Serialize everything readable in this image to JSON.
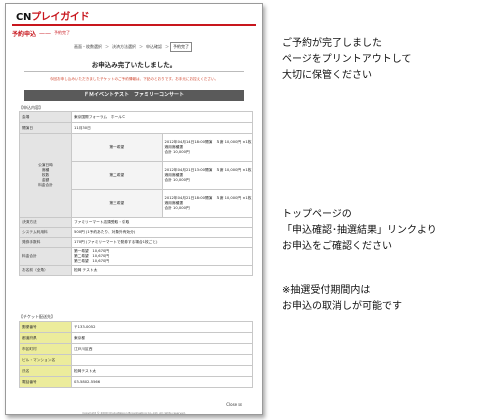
{
  "screenshot": {
    "logo": {
      "cn": "CN",
      "play": "プレイガイド"
    },
    "page_title": "予約申込",
    "page_subtitle": "予約完了",
    "steps": [
      "画面・枚数選択",
      "決済方法選択",
      "申込確認",
      "予約完了"
    ],
    "current_step_index": 3,
    "done_message": "お申込み完了いたしました。",
    "notice_lines": [
      "今回お申し込みいただきましたチケットのご予約情報は、下記のとおりです。お手元にお控えください。"
    ],
    "event_title": "ＦＭイベントテスト　ファミリーコンサート",
    "reservation_section": "【申込内容】",
    "reservation_rows": {
      "venue_label": "会場",
      "venue_value": "東京国際フォーラム　ホールＣ",
      "date_label": "開演日",
      "date_value": "11月30日",
      "seat_label": "公演日時\n席種\n枚数\n金額\n料金合計",
      "prize_groups": [
        {
          "label": "第一希望",
          "lines": [
            "2012年04月14日18:00開演　Ｓ席 10,000円 ×1枚",
            "適用席種選",
            "合計 10,000円"
          ]
        },
        {
          "label": "第二希望",
          "lines": [
            "2012年04月21日13:00開演　Ｓ席 10,000円 ×1枚",
            "適用席種選",
            "合計 10,000円"
          ]
        },
        {
          "label": "第三希望",
          "lines": [
            "2012年04月21日18:00開演　Ｓ席 10,000円 ×1枚",
            "適用席種選",
            "合計 10,000円"
          ]
        }
      ],
      "payment_label": "決済方法",
      "payment_value": "ファミリーマート店頭受取・引取",
      "system_fee_label": "システム利用料",
      "system_fee_value": "500円 (1予約あたり、対象外有効分)",
      "ticket_fee_label": "発券手数料",
      "ticket_fee_value": "170円 (ファミリーマートで発券する場合1枚ごと)",
      "total_label": "料金合計",
      "total_lines": [
        "第一希望　10,670円",
        "第二希望　10,670円",
        "第三希望　10,670円"
      ],
      "name_label": "お名前（全角）",
      "name_value": "松岡 テスト太"
    },
    "ticket_section": "【チケット配送先】",
    "ticket_rows": [
      {
        "label": "郵便番号",
        "value": "〒133-0052"
      },
      {
        "label": "都道府県",
        "value": "東京都"
      },
      {
        "label": "市区町村",
        "value": "江戸川区西"
      },
      {
        "label": "ビル・マンション名",
        "value": ""
      },
      {
        "label": "氏名",
        "value": "松岡テスト太"
      },
      {
        "label": "電話番号",
        "value": "03-5802-5566"
      }
    ],
    "close_label": "Close ☒",
    "footer": "Copyright © 2009 ChubuNippon Broadcasting Co.,Ltd. All rights reserved."
  },
  "captions": {
    "block1": [
      "ご予約が完了しました",
      "ページをプリントアウトして",
      "大切に保管ください"
    ],
    "block2": [
      "トップページの",
      "「申込確認･抽選結果」リンクより",
      "お申込をご確認ください"
    ],
    "block3": [
      "※抽選受付期間内は",
      "お申込の取消しが可能です"
    ]
  }
}
